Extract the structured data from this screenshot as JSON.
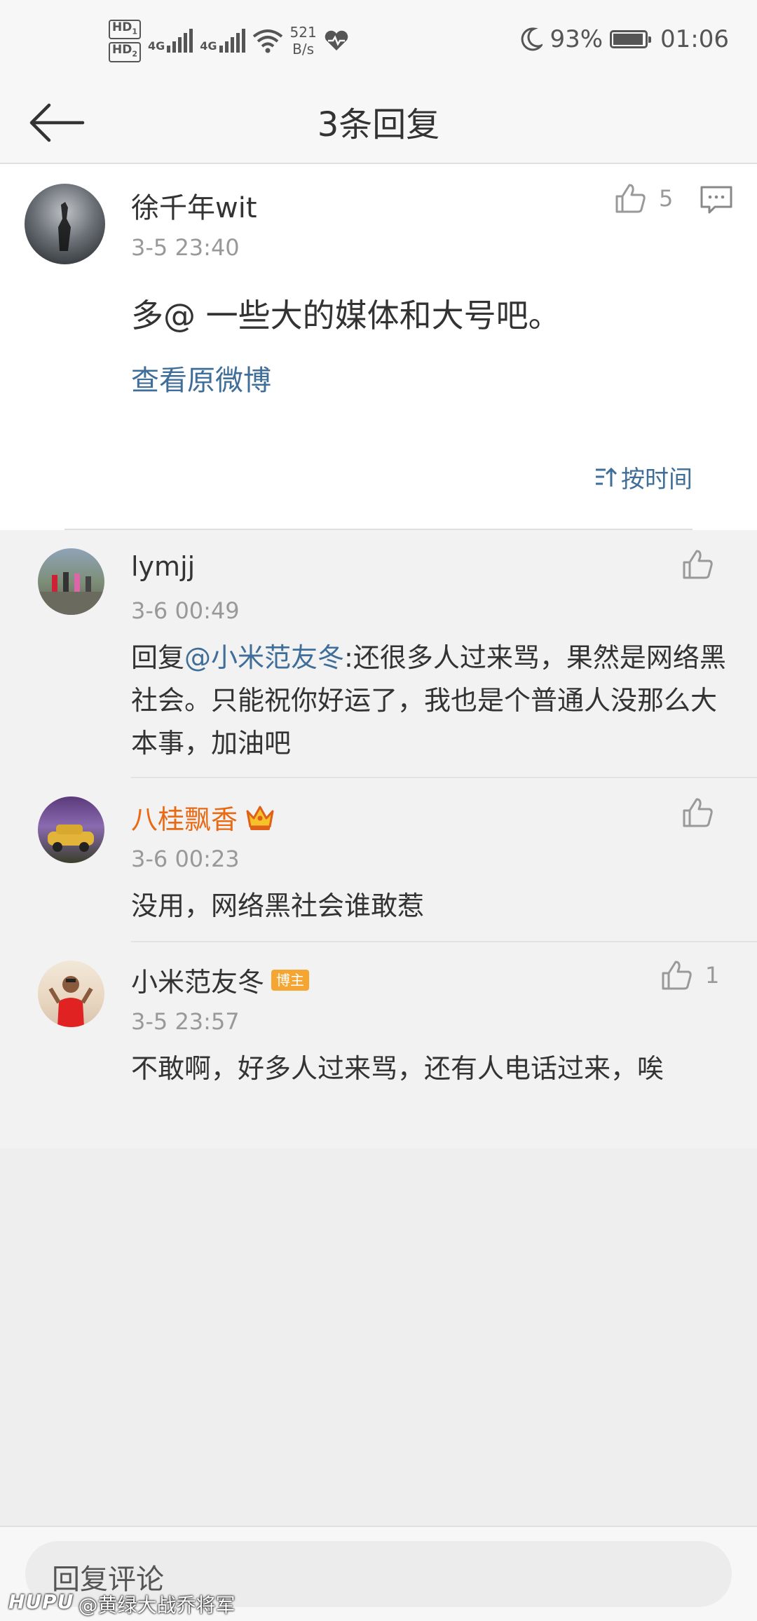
{
  "status_bar": {
    "hd1": "HD",
    "hd1_sub": "1",
    "hd2": "HD",
    "hd2_sub": "2",
    "net1": "4G",
    "net2": "4G",
    "speed_value": "521",
    "speed_unit": "B/s",
    "battery": "93%",
    "time": "01:06"
  },
  "header": {
    "title": "3条回复",
    "back_icon": "arrow-left-icon"
  },
  "original_comment": {
    "author": "徐千年wit",
    "time": "3-5 23:40",
    "likes": "5",
    "text": "多@ 一些大的媒体和大号吧。",
    "view_original": "查看原微博",
    "sort_label": "按时间"
  },
  "replies": [
    {
      "author": "lymjj",
      "time": "3-6 00:49",
      "prefix": "回复",
      "mention": "@小米范友冬",
      "text": ":还很多人过来骂，果然是网络黑社会。只能祝你好运了，我也是个普通人没那么大本事，加油吧",
      "likes": ""
    },
    {
      "author": "八桂飘香",
      "time": "3-6 00:23",
      "text": "没用，网络黑社会谁敢惹",
      "likes": ""
    },
    {
      "author": "小米范友冬",
      "badge": "博主",
      "time": "3-5 23:57",
      "text": "不敢啊，好多人过来骂，还有人电话过来，唉",
      "likes": "1"
    }
  ],
  "footer": {
    "reply_placeholder": "回复评论",
    "watermark_brand": "HUPU",
    "watermark_user": "@黄绿大战乔将军"
  },
  "colors": {
    "link": "#3f6e99",
    "vip_name": "#e86a14",
    "badge": "#f4a532"
  }
}
